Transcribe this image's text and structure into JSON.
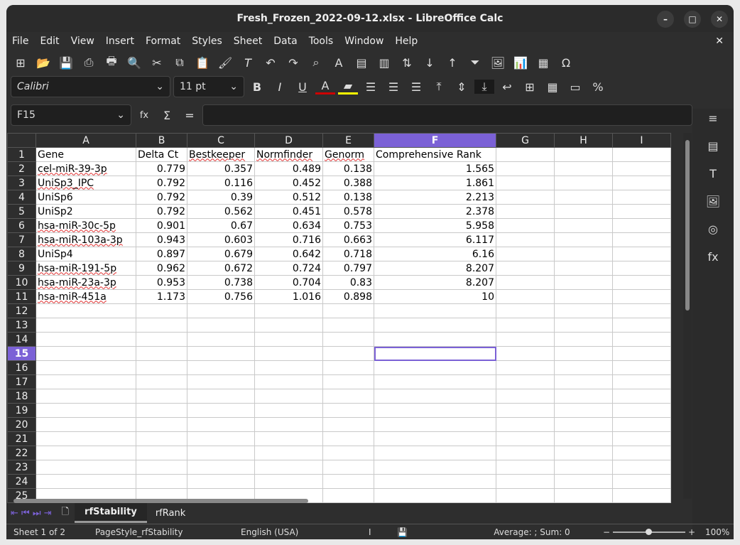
{
  "title": "Fresh_Frozen_2022-09-12.xlsx - LibreOffice Calc",
  "menu": [
    "File",
    "Edit",
    "View",
    "Insert",
    "Format",
    "Styles",
    "Sheet",
    "Data",
    "Tools",
    "Window",
    "Help"
  ],
  "font_name": "Calibri",
  "font_size": "11 pt",
  "name_box": "F15",
  "formula": "",
  "columns": [
    "A",
    "B",
    "C",
    "D",
    "E",
    "F",
    "G",
    "H",
    "I"
  ],
  "rows": [
    [
      "Gene",
      "Delta Ct",
      "Bestkeeper",
      "Normfinder",
      "Genorm",
      "Comprehensive Rank"
    ],
    [
      "cel-miR-39-3p",
      "0.779",
      "0.357",
      "0.489",
      "0.138",
      "1.565"
    ],
    [
      "UniSp3_IPC",
      "0.792",
      "0.116",
      "0.452",
      "0.388",
      "1.861"
    ],
    [
      "UniSp6",
      "0.792",
      "0.39",
      "0.512",
      "0.138",
      "2.213"
    ],
    [
      "UniSp2",
      "0.792",
      "0.562",
      "0.451",
      "0.578",
      "2.378"
    ],
    [
      "hsa-miR-30c-5p",
      "0.901",
      "0.67",
      "0.634",
      "0.753",
      "5.958"
    ],
    [
      "hsa-miR-103a-3p",
      "0.943",
      "0.603",
      "0.716",
      "0.663",
      "6.117"
    ],
    [
      "UniSp4",
      "0.897",
      "0.679",
      "0.642",
      "0.718",
      "6.16"
    ],
    [
      "hsa-miR-191-5p",
      "0.962",
      "0.672",
      "0.724",
      "0.797",
      "8.207"
    ],
    [
      "hsa-miR-23a-3p",
      "0.953",
      "0.738",
      "0.704",
      "0.83",
      "8.207"
    ],
    [
      "hsa-miR-451a",
      "1.173",
      "0.756",
      "1.016",
      "0.898",
      "10"
    ]
  ],
  "total_rows": 25,
  "sheets": [
    "rfStability",
    "rfRank"
  ],
  "status": {
    "sheet": "Sheet 1 of 2",
    "page_style": "PageStyle_rfStability",
    "language": "English (USA)",
    "summary": "Average: ; Sum: 0",
    "zoom": "100%"
  },
  "zoom_level": 100
}
